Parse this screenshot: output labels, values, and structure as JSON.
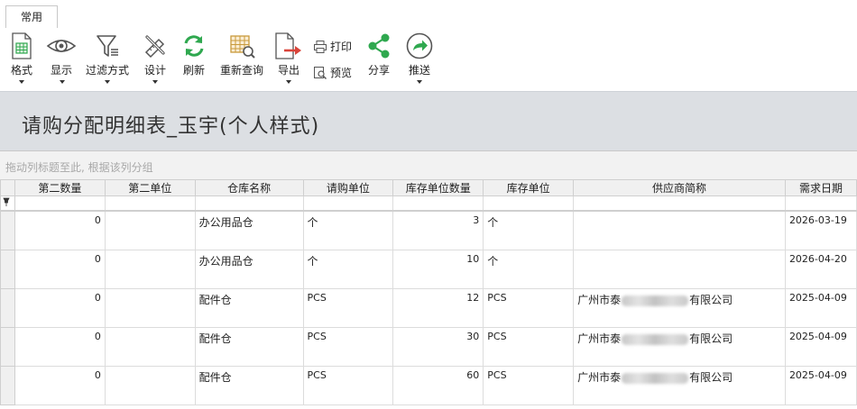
{
  "tabs": [
    {
      "label": "常用"
    }
  ],
  "ribbon": {
    "format": "格式",
    "display": "显示",
    "filter": "过滤方式",
    "design": "设计",
    "refresh": "刷新",
    "requery": "重新查询",
    "export": "导出",
    "print": "打印",
    "preview": "预览",
    "share": "分享",
    "push": "推送"
  },
  "page": {
    "title": "请购分配明细表_玉宇(个人样式)",
    "group_hint": "拖动列标题至此, 根据该列分组"
  },
  "grid": {
    "columns": [
      "第二数量",
      "第二单位",
      "仓库名称",
      "请购单位",
      "库存单位数量",
      "库存单位",
      "供应商简称",
      "需求日期"
    ],
    "rows": [
      {
        "qty2": "0",
        "unit2": "",
        "warehouse": "办公用品仓",
        "req_unit": "个",
        "stock_qty": "3",
        "stock_unit": "个",
        "supplier_prefix": "",
        "supplier_suffix": "",
        "date": "2026-03-19"
      },
      {
        "qty2": "0",
        "unit2": "",
        "warehouse": "办公用品仓",
        "req_unit": "个",
        "stock_qty": "10",
        "stock_unit": "个",
        "supplier_prefix": "",
        "supplier_suffix": "",
        "date": "2026-04-20"
      },
      {
        "qty2": "0",
        "unit2": "",
        "warehouse": "配件仓",
        "req_unit": "PCS",
        "stock_qty": "12",
        "stock_unit": "PCS",
        "supplier_prefix": "广州市泰",
        "supplier_suffix": "有限公司",
        "date": "2025-04-09"
      },
      {
        "qty2": "0",
        "unit2": "",
        "warehouse": "配件仓",
        "req_unit": "PCS",
        "stock_qty": "30",
        "stock_unit": "PCS",
        "supplier_prefix": "广州市泰",
        "supplier_suffix": "有限公司",
        "date": "2025-04-09"
      },
      {
        "qty2": "0",
        "unit2": "",
        "warehouse": "配件仓",
        "req_unit": "PCS",
        "stock_qty": "60",
        "stock_unit": "PCS",
        "supplier_prefix": "广州市泰",
        "supplier_suffix": "有限公司",
        "date": "2025-04-09"
      }
    ]
  },
  "colors": {
    "accent_green": "#2fa84f",
    "accent_red": "#d9443a",
    "title_bg": "#dcdfe3"
  }
}
